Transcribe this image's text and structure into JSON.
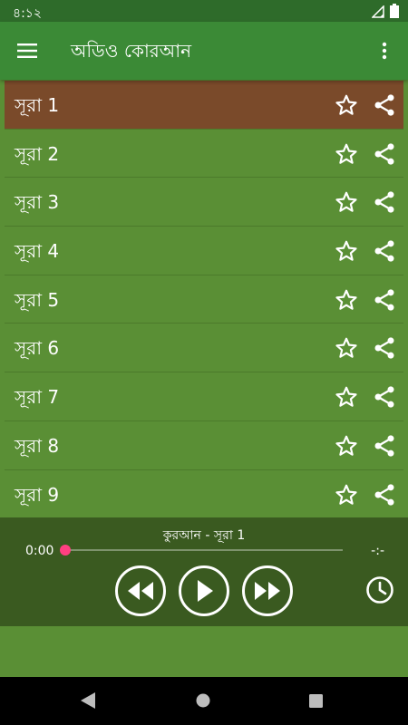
{
  "status_bar": {
    "time": "৪:১২"
  },
  "app_bar": {
    "title": "অডিও কোরআন"
  },
  "list": {
    "items": [
      {
        "label": "সূরা 1",
        "selected": true
      },
      {
        "label": "সূরা 2",
        "selected": false
      },
      {
        "label": "সূরা 3",
        "selected": false
      },
      {
        "label": "সূরা 4",
        "selected": false
      },
      {
        "label": "সূরা 5",
        "selected": false
      },
      {
        "label": "সূরা 6",
        "selected": false
      },
      {
        "label": "সূরা 7",
        "selected": false
      },
      {
        "label": "সূরা 8",
        "selected": false
      },
      {
        "label": "সূরা 9",
        "selected": false
      }
    ]
  },
  "player": {
    "track_title": "কুরআন - সূরা 1",
    "current_time": "0:00",
    "total_time": "-:-",
    "progress": 0
  },
  "colors": {
    "status_bar": "#2e6b2a",
    "app_bar": "#3b8a36",
    "list_bg": "#5a8f35",
    "selected_row": "#7a4a2a",
    "player_bg": "#3a5a20",
    "seek_thumb": "#ff4081"
  },
  "icons": {
    "menu": "hamburger-menu-icon",
    "overflow": "more-vert-icon",
    "favorite": "star-outline-icon",
    "share": "share-icon",
    "rewind": "fast-rewind-icon",
    "play": "play-icon",
    "forward": "fast-forward-icon",
    "timer": "clock-icon"
  }
}
